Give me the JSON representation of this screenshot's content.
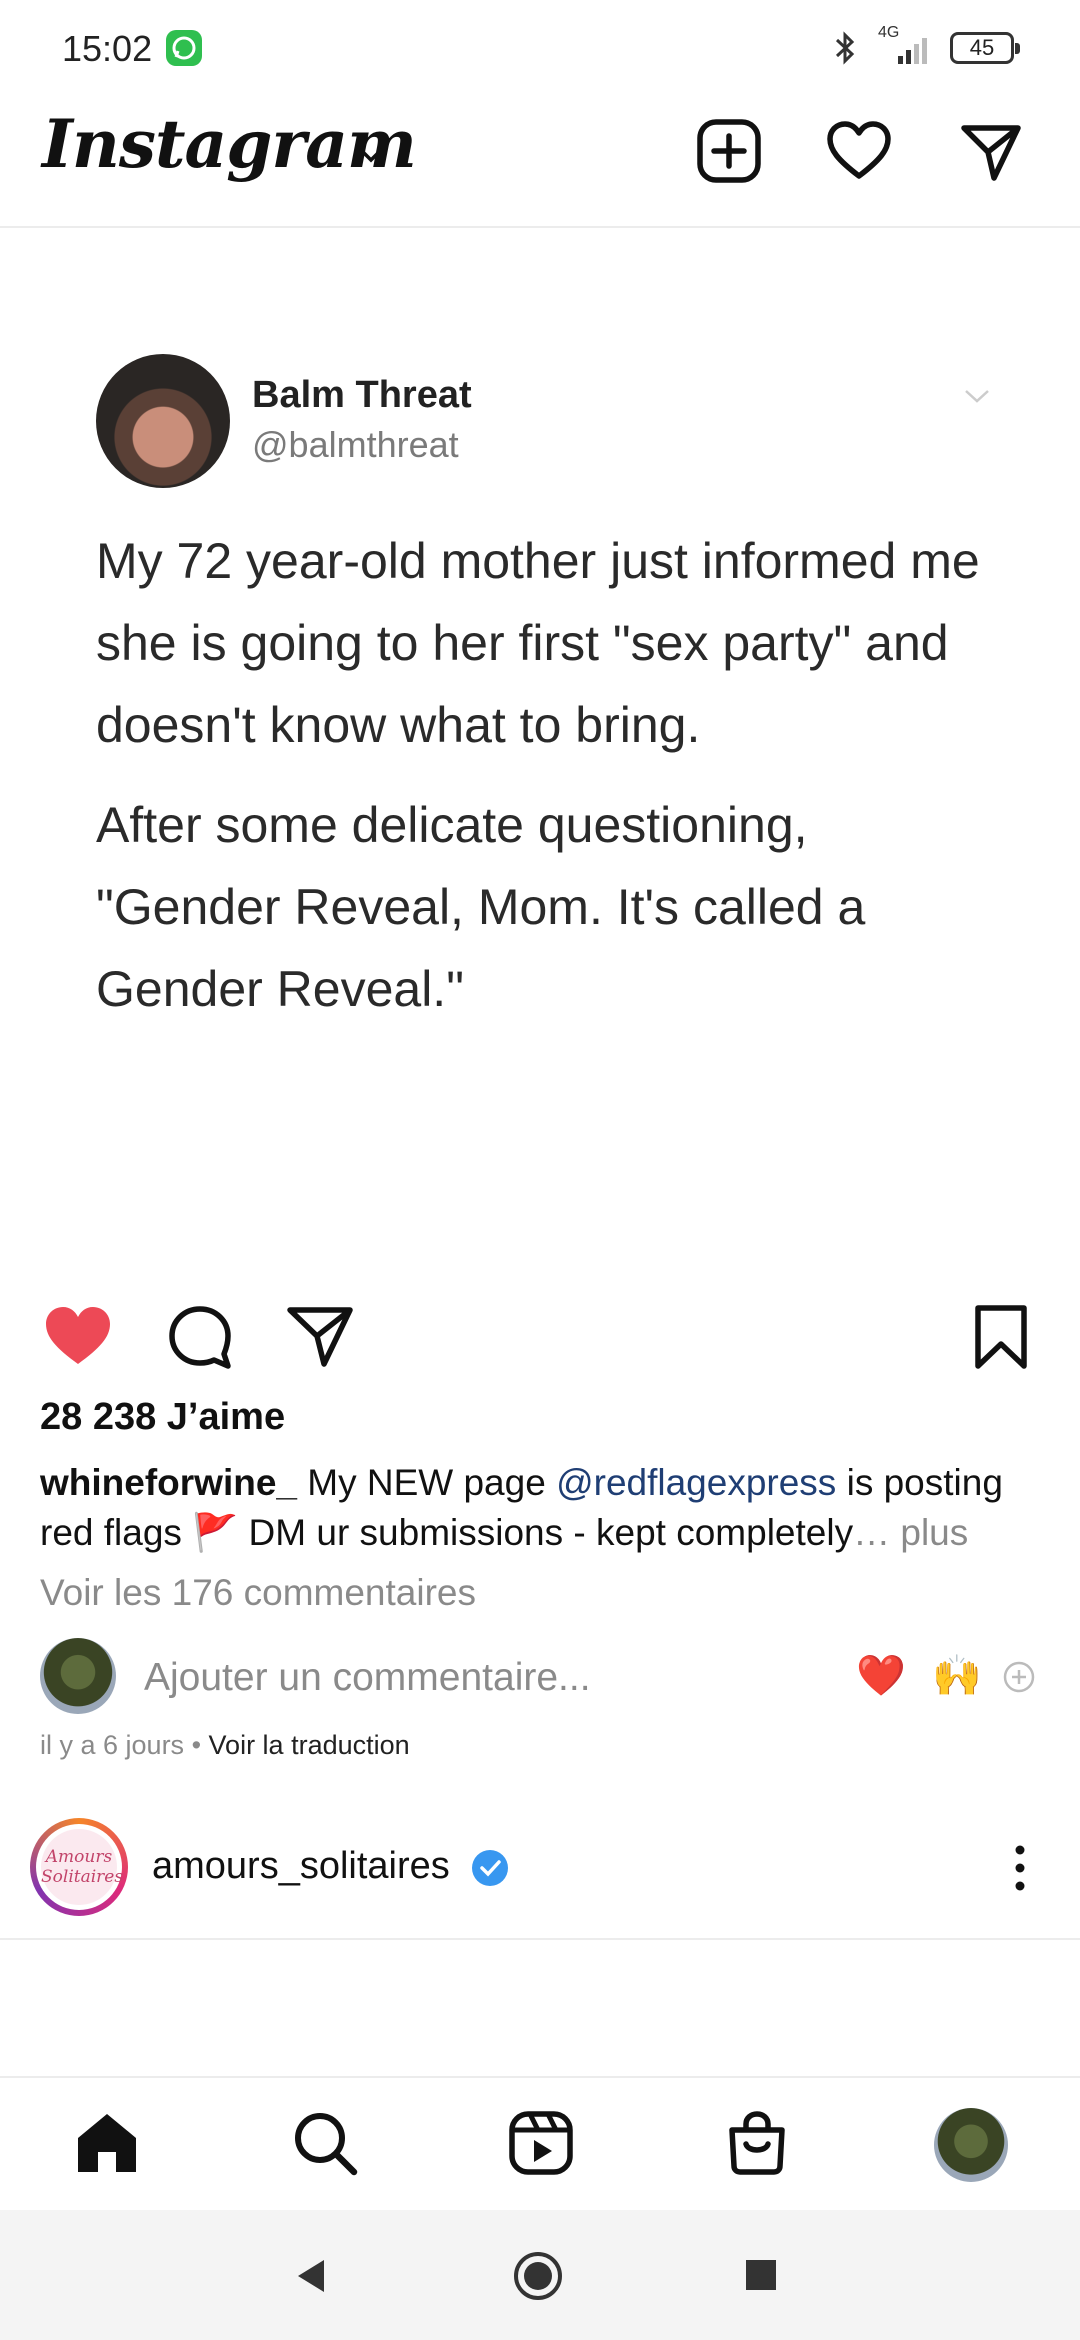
{
  "status_bar": {
    "time": "15:02",
    "battery": "45",
    "network": "4G"
  },
  "header": {
    "logo": "Instagram"
  },
  "tweet": {
    "name": "Balm Threat",
    "handle": "@balmthreat",
    "paragraph1": "My 72 year-old mother just informed me she is going to her first \"sex party\" and doesn't know what to bring.",
    "paragraph2": "After some delicate questioning, \"Gender Reveal, Mom. It's called a Gender Reveal.\""
  },
  "post": {
    "likes": "28 238 J’aime",
    "username": "whineforwine_",
    "caption_part1": " My NEW page ",
    "mention": "@redflagexpress",
    "caption_part2": " is posting red flags ",
    "flag_emoji": "🚩",
    "caption_part3": " DM ur submissions - kept completely",
    "more": "… plus",
    "view_comments": "Voir les 176 commentaires",
    "comment_placeholder": "Ajouter un commentaire...",
    "quick_reactions": [
      "❤️",
      "🙌"
    ],
    "time_ago": "il y a 6 jours",
    "separator": " • ",
    "translate": "Voir la traduction"
  },
  "next_post": {
    "username": "amours_solitaires",
    "avatar_text": "Amours Solitaires"
  },
  "colors": {
    "like_red": "#ed4956",
    "verified_blue": "#3897f0",
    "link_blue": "#1f3e74"
  },
  "icons": {
    "header": [
      "new-post-icon",
      "heart-icon",
      "direct-message-icon"
    ],
    "post_actions": [
      "heart-filled-icon",
      "comment-icon",
      "share-icon",
      "bookmark-icon"
    ],
    "bottom_nav": [
      "home-icon",
      "search-icon",
      "reels-icon",
      "shop-icon",
      "profile-avatar"
    ],
    "system_nav": [
      "back-icon",
      "home-circle-icon",
      "recents-icon"
    ]
  }
}
